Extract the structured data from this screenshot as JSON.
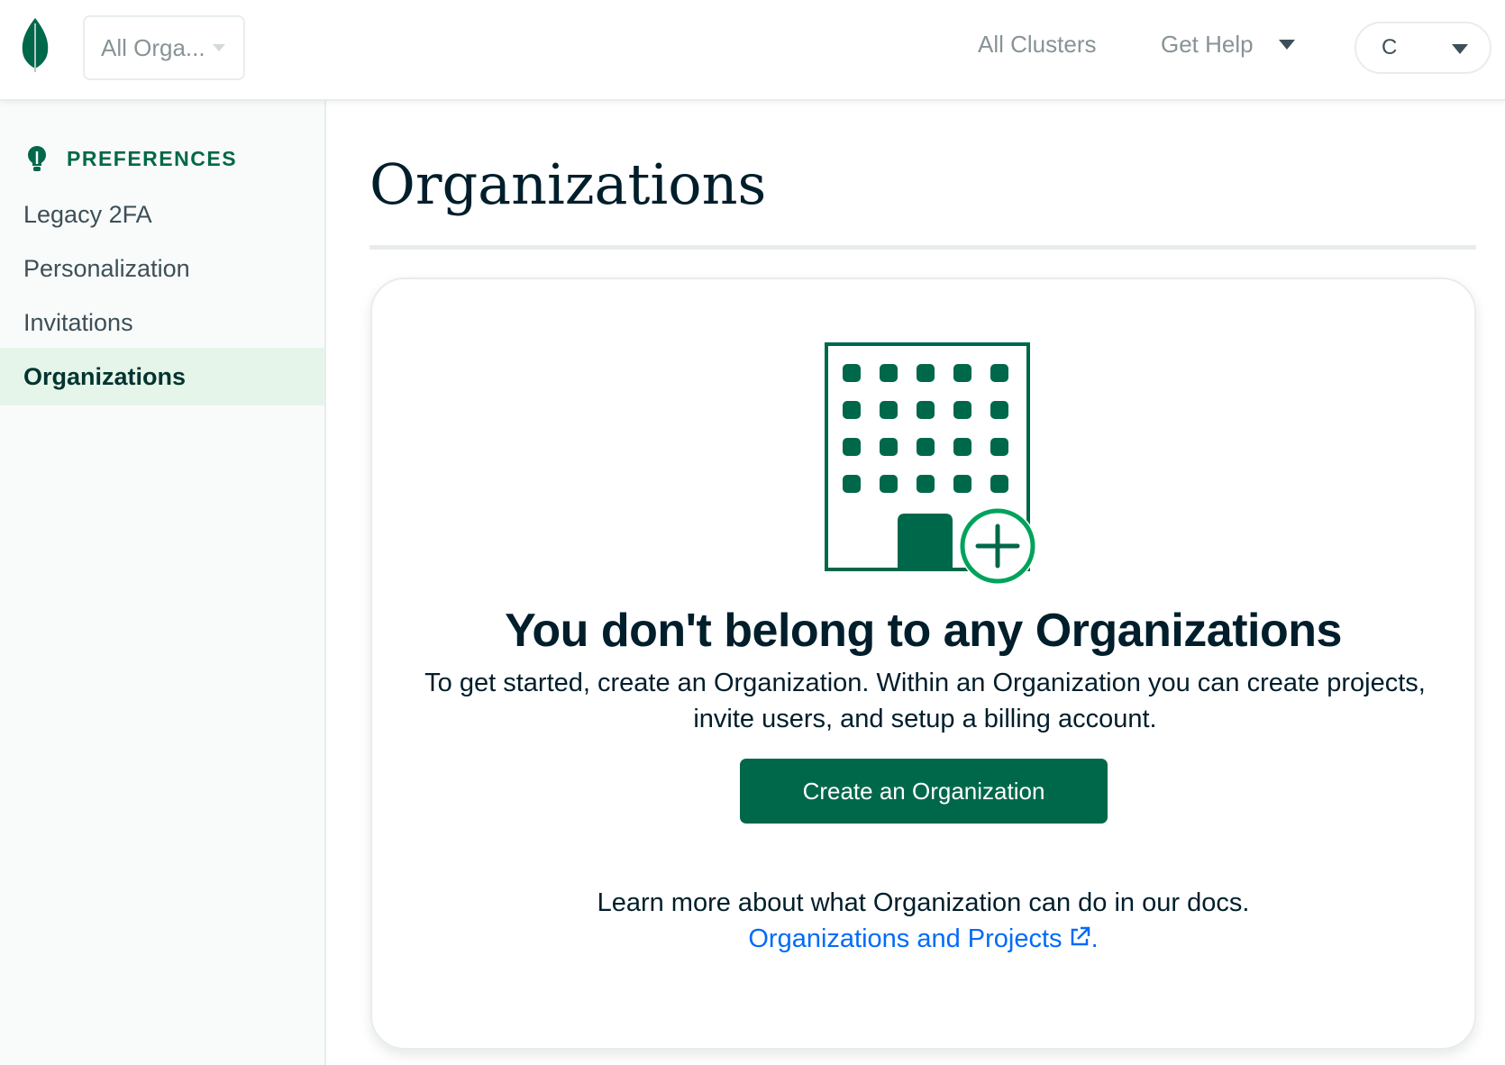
{
  "header": {
    "org_selector": "All Orga...",
    "nav_clusters": "All Clusters",
    "nav_help": "Get Help",
    "user_initial": "C"
  },
  "sidebar": {
    "section_title": "PREFERENCES",
    "items": [
      {
        "label": "Legacy 2FA",
        "active": false
      },
      {
        "label": "Personalization",
        "active": false
      },
      {
        "label": "Invitations",
        "active": false
      },
      {
        "label": "Organizations",
        "active": true
      }
    ]
  },
  "main": {
    "title": "Organizations",
    "empty_state": {
      "title": "You don't belong to any Organizations",
      "description": "To get started, create an Organization. Within an Organization you can create projects, invite users, and setup a billing account.",
      "button_label": "Create an Organization",
      "docs_text": "Learn more about what Organization can do in our docs.",
      "docs_link": "Organizations and Projects",
      "docs_link_suffix": "."
    }
  },
  "colors": {
    "brand_green": "#00684a",
    "accent_green": "#00a35c",
    "link_blue": "#016bf8",
    "active_bg": "#e6f5e9"
  },
  "icons": [
    "mongodb-leaf-icon",
    "chevron-down-icon",
    "lightbulb-icon",
    "building-icon",
    "plus-circle-icon",
    "external-link-icon"
  ]
}
